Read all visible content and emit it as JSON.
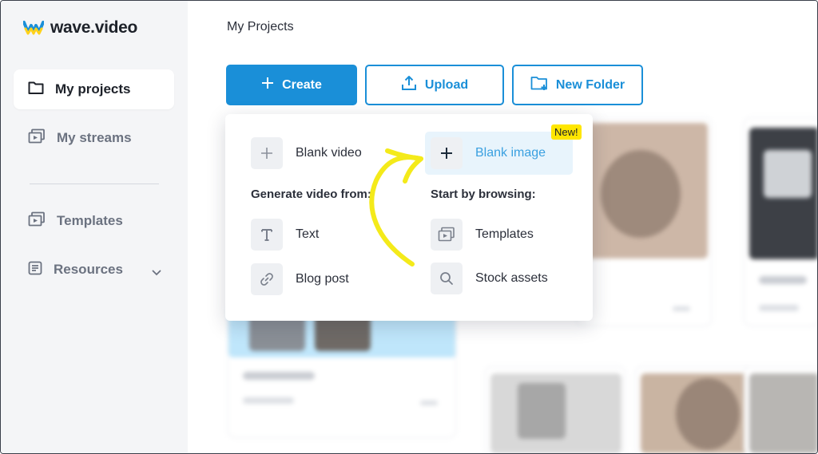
{
  "app": {
    "logo_text": "wave.video"
  },
  "sidebar": {
    "items": [
      {
        "label": "My projects",
        "icon": "folder-icon"
      },
      {
        "label": "My streams",
        "icon": "streams-icon"
      },
      {
        "label": "Templates",
        "icon": "templates-icon"
      },
      {
        "label": "Resources",
        "icon": "resources-icon"
      }
    ]
  },
  "header": {
    "breadcrumb": "My Projects"
  },
  "toolbar": {
    "create_label": "Create",
    "upload_label": "Upload",
    "new_folder_label": "New Folder"
  },
  "create_menu": {
    "blank_video": "Blank video",
    "blank_image": "Blank image",
    "new_badge": "New!",
    "generate_heading": "Generate video from:",
    "browse_heading": "Start by browsing:",
    "text_item": "Text",
    "blog_post_item": "Blog post",
    "templates_item": "Templates",
    "stock_assets_item": "Stock assets"
  },
  "colors": {
    "accent": "#1a8fd8",
    "highlight_arrow": "#f4ea1a",
    "badge": "#ffe600",
    "blank_image_icon_bg": "#9eecd4"
  }
}
